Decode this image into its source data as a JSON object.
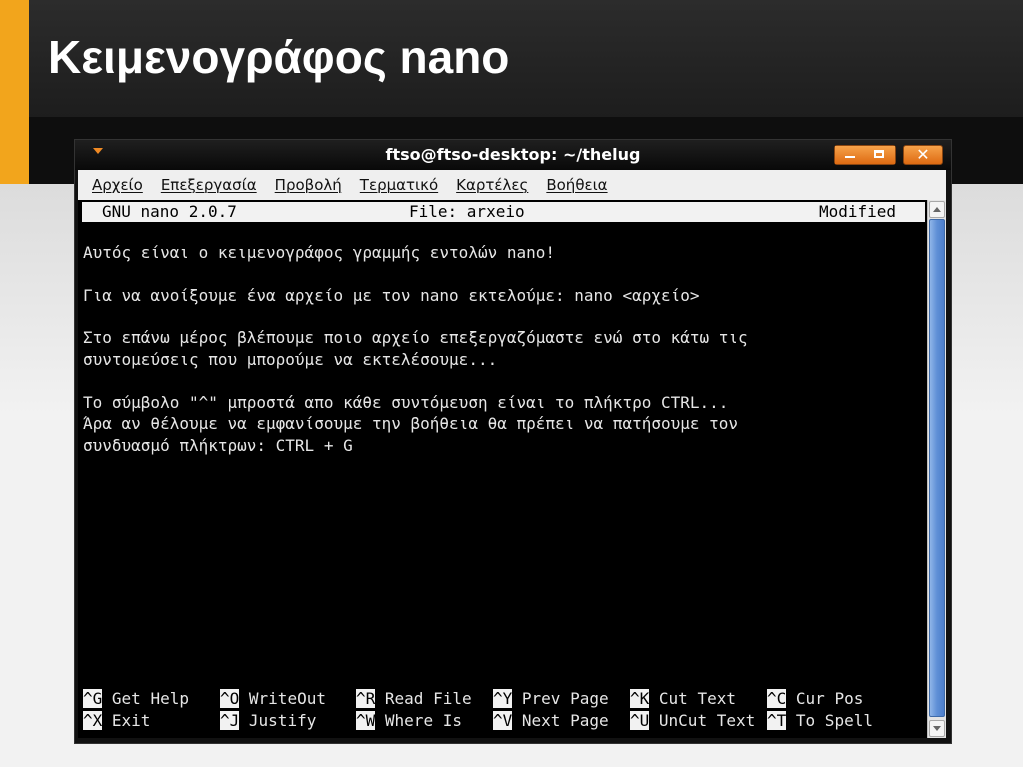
{
  "slide": {
    "title": "Κειμενογράφος nano"
  },
  "window": {
    "title": "ftso@ftso-desktop: ~/thelug",
    "close_label": "✕"
  },
  "menu": [
    {
      "label": "Αρχείο"
    },
    {
      "label": "Επεξεργασία"
    },
    {
      "label": "Προβολή"
    },
    {
      "label": "Τερματικό"
    },
    {
      "label": "Καρτέλες"
    },
    {
      "label": "Βοήθεια"
    }
  ],
  "nano": {
    "version": "GNU nano 2.0.7",
    "file_label": "File: arxeio",
    "status": "Modified",
    "lines": [
      "Αυτός είναι ο κειμενογράφος γραμμής εντολών nano!",
      "Για να ανοίξουμε ένα αρχείο με τον nano εκτελούμε: nano <αρχείο>",
      "Στο επάνω μέρος βλέπουμε ποιο αρχείο επεξεργαζόμαστε ενώ στο κάτω τις",
      "συντομεύσεις που μπορούμε να εκτελέσουμε...",
      "Το σύμβολο \"^\" μπροστά απο κάθε συντόμευση είναι το πλήκτρο CTRL...",
      "Άρα αν θέλουμε να εμφανίσουμε την βοήθεια θα πρέπει να πατήσουμε τον",
      "συνδυασμό πλήκτρων: CTRL + G"
    ],
    "shortcuts_row1": [
      {
        "key": "^G",
        "label": "Get Help"
      },
      {
        "key": "^O",
        "label": "WriteOut"
      },
      {
        "key": "^R",
        "label": "Read File"
      },
      {
        "key": "^Y",
        "label": "Prev Page"
      },
      {
        "key": "^K",
        "label": "Cut Text"
      },
      {
        "key": "^C",
        "label": "Cur Pos"
      }
    ],
    "shortcuts_row2": [
      {
        "key": "^X",
        "label": "Exit"
      },
      {
        "key": "^J",
        "label": "Justify"
      },
      {
        "key": "^W",
        "label": "Where Is"
      },
      {
        "key": "^V",
        "label": "Next Page"
      },
      {
        "key": "^U",
        "label": "UnCut Text"
      },
      {
        "key": "^T",
        "label": "To Spell"
      }
    ]
  },
  "colors": {
    "accent": "#f2a51c",
    "window_buttons": "#e8801e",
    "scrollbar_thumb": "#5f8fd6"
  }
}
